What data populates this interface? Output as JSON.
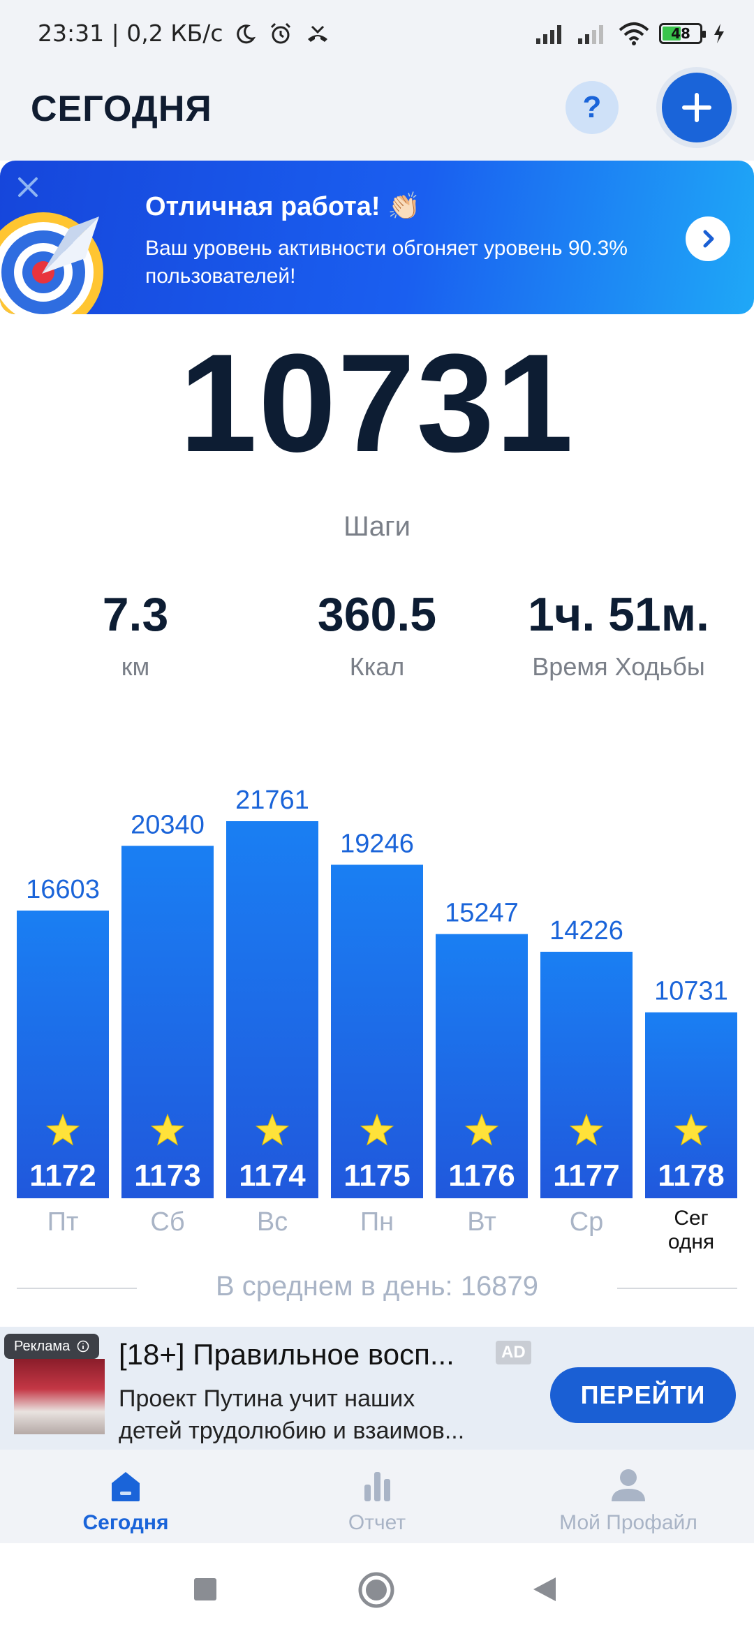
{
  "status_bar": {
    "time": "23:31",
    "speed": "0,2 КБ/с",
    "battery": "48"
  },
  "header": {
    "title": "СЕГОДНЯ",
    "help_label": "?"
  },
  "banner": {
    "title": "Отличная работа! 👏🏻",
    "text": "Ваш уровень активности обгоняет уровень 90.3% пользователей!"
  },
  "today": {
    "steps": "10731",
    "steps_label": "Шаги",
    "distance_value": "7.3",
    "distance_unit": "км",
    "calories_value": "360.5",
    "calories_unit": "Ккал",
    "walk_time_value": "1ч. 51м.",
    "walk_time_label": "Время Ходьбы"
  },
  "chart_data": {
    "type": "bar",
    "categories": [
      "Пт",
      "Сб",
      "Вс",
      "Пн",
      "Вт",
      "Ср",
      "Сег\nодня"
    ],
    "values": [
      16603,
      20340,
      21761,
      19246,
      15247,
      14226,
      10731
    ],
    "day_numbers": [
      "1172",
      "1173",
      "1174",
      "1175",
      "1176",
      "1177",
      "1178"
    ],
    "bar_color": "#1a74f0",
    "ylim": [
      0,
      21761
    ]
  },
  "average": {
    "text": "В среднем в день: 16879"
  },
  "ad": {
    "badge": "Реклама",
    "title": "[18+] Правильное восп...",
    "tag": "AD",
    "desc_line1": "Проект Путина учит наших",
    "desc_line2": "детей трудолюбию и взаимов...",
    "cta": "ПЕРЕЙТИ"
  },
  "tabs": [
    {
      "label": "Сегодня",
      "active": true
    },
    {
      "label": "Отчет",
      "active": false
    },
    {
      "label": "Мой Профайл",
      "active": false
    }
  ],
  "colors": {
    "accent": "#1a64d9",
    "inactive": "#a9b4c6"
  }
}
